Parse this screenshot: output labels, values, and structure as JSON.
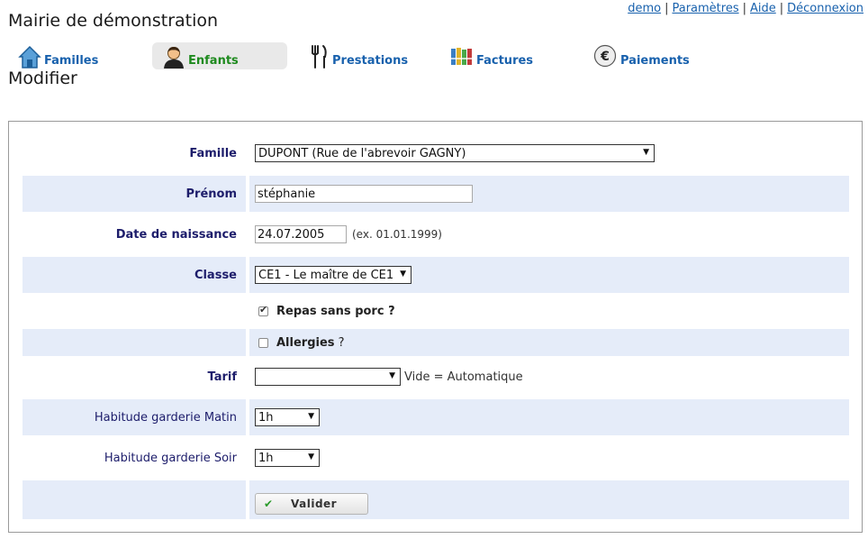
{
  "header": {
    "site_title": "Mairie de démonstration",
    "links": [
      "demo",
      "Paramètres",
      "Aide",
      "Déconnexion"
    ],
    "separator": "|"
  },
  "tabs": [
    {
      "label": "Familles",
      "icon": "house-icon"
    },
    {
      "label": "Enfants",
      "icon": "child-icon",
      "active": true
    },
    {
      "label": "Prestations",
      "icon": "cutlery-icon"
    },
    {
      "label": "Factures",
      "icon": "binders-icon"
    },
    {
      "label": "Paiements",
      "icon": "euro-icon"
    }
  ],
  "page_heading": "Modifier",
  "form": {
    "famille": {
      "label": "Famille",
      "value": "DUPONT (Rue de l'abrevoir GAGNY)"
    },
    "prenom": {
      "label": "Prénom",
      "value": "stéphanie"
    },
    "date_naissance": {
      "label": "Date de naissance",
      "value": "24.07.2005",
      "hint": "(ex. 01.01.1999)"
    },
    "classe": {
      "label": "Classe",
      "value": "CE1 - Le maître de CE1"
    },
    "repas_sans_porc": {
      "label": "Repas sans porc ?",
      "checked": true
    },
    "allergies": {
      "label": "Allergies",
      "suffix": "?",
      "checked": false
    },
    "tarif": {
      "label": "Tarif",
      "value": "",
      "hint": "Vide = Automatique"
    },
    "garderie_matin": {
      "label": "Habitude garderie Matin",
      "value": "1h"
    },
    "garderie_soir": {
      "label": "Habitude garderie Soir",
      "value": "1h"
    },
    "submit_label": "Valider"
  },
  "colors": {
    "link": "#1861ad",
    "active_tab": "#1e8a1e",
    "label": "#1d1d6b",
    "row_shade": "#e5ecf9"
  }
}
